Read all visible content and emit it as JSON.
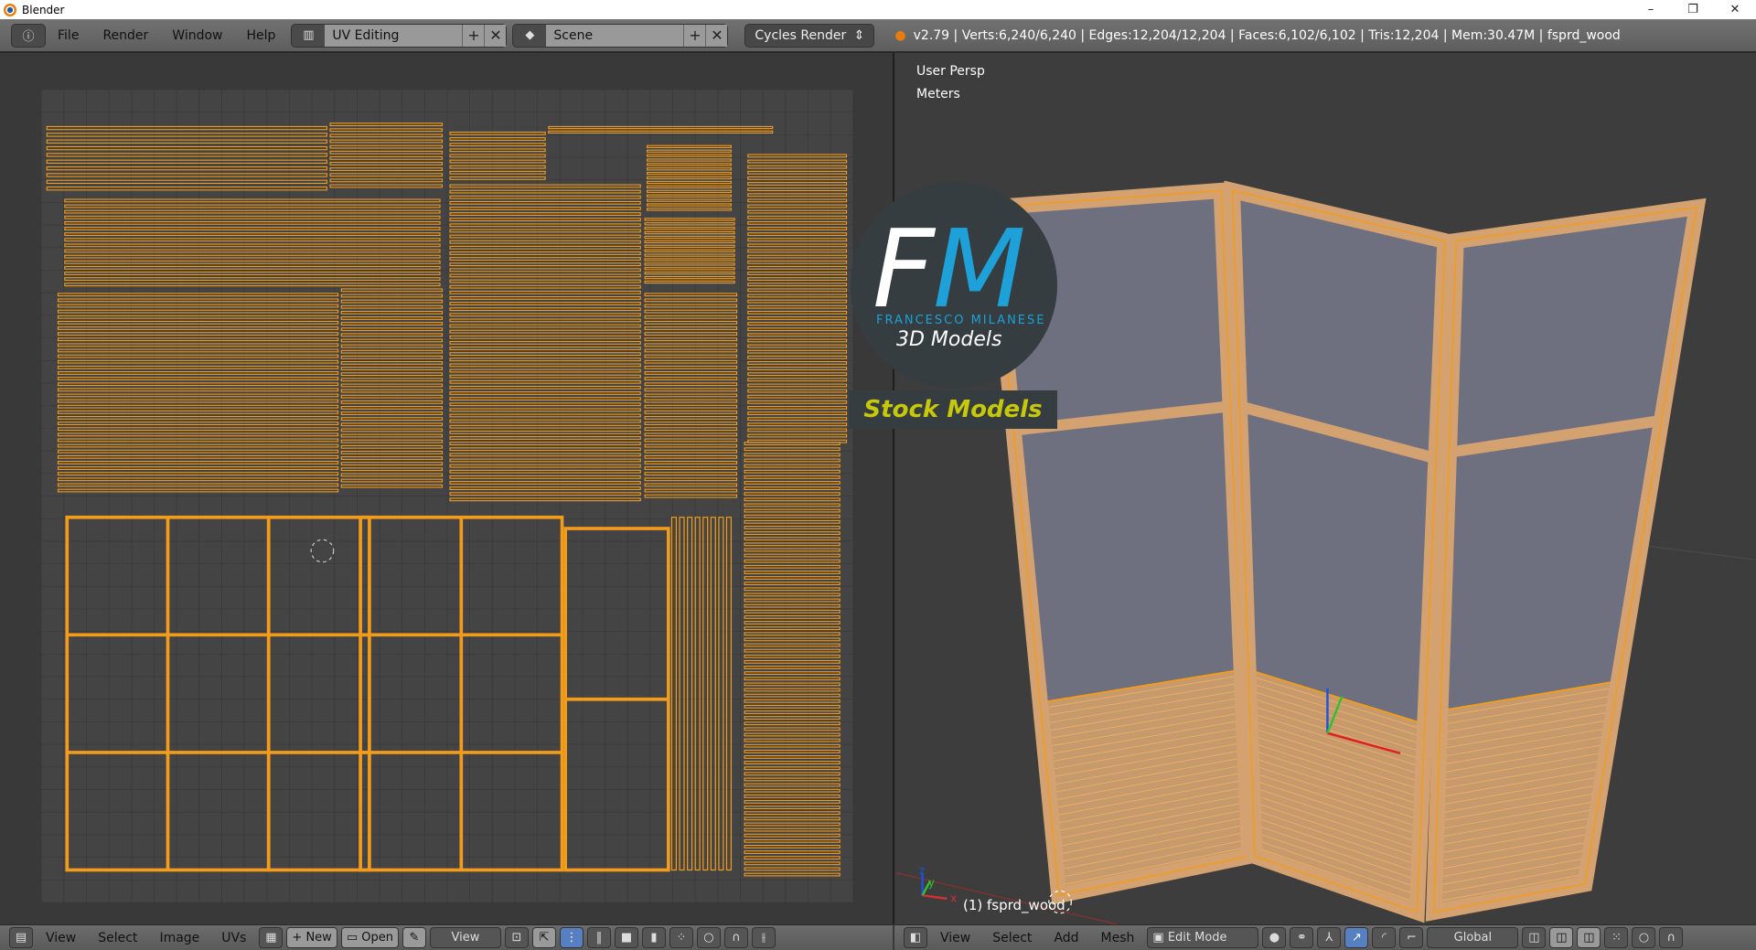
{
  "window": {
    "title": "Blender",
    "minimize": "–",
    "restore": "❐",
    "close": "✕"
  },
  "header": {
    "menus": [
      "File",
      "Render",
      "Window",
      "Help"
    ],
    "screen_layout": "UV Editing",
    "scene": "Scene",
    "render_engine": "Cycles Render",
    "stats": "v2.79 | Verts:6,240/6,240 | Edges:12,204/12,204 | Faces:6,102/6,102 | Tris:12,204 | Mem:30.47M | fsprd_wood"
  },
  "uv_editor": {
    "menus": [
      "View",
      "Select",
      "Image",
      "UVs"
    ],
    "new_label": "New",
    "open_label": "Open",
    "view_label": "View"
  },
  "viewport": {
    "view_name": "User Persp",
    "units": "Meters",
    "object_label": "(1) fsprd_wood",
    "menus": [
      "View",
      "Select",
      "Add",
      "Mesh"
    ],
    "mode": "Edit Mode",
    "orientation": "Global",
    "axes": {
      "x": "x",
      "y": "y",
      "z": "z"
    }
  },
  "watermark": {
    "initial_f": "F",
    "initial_m": "M",
    "name": "FRANCESCO MILANESE",
    "subtitle": "3D Models",
    "banner": "Stock Models"
  },
  "colors": {
    "accent": "#f39c1c",
    "brand_blue": "#1da1d8",
    "banner_text": "#c8c80a"
  }
}
